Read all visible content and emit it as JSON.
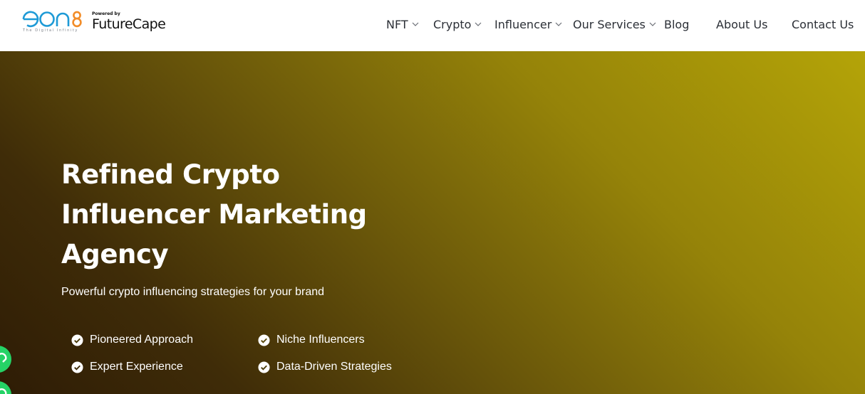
{
  "header": {
    "logo": {
      "brand_text": "eon8",
      "tagline": "The Digital Infinity",
      "powered_by": "Powered by",
      "partner": "FutureCape"
    },
    "nav": [
      {
        "label": "NFT",
        "has_dropdown": true
      },
      {
        "label": "Crypto",
        "has_dropdown": true
      },
      {
        "label": "Influencer",
        "has_dropdown": true
      },
      {
        "label": "Our Services",
        "has_dropdown": true
      },
      {
        "label": "Blog",
        "has_dropdown": false
      },
      {
        "label": "About Us",
        "has_dropdown": false
      },
      {
        "label": "Contact Us",
        "has_dropdown": false
      }
    ]
  },
  "hero": {
    "title_lines": [
      "Refined Crypto",
      "Influencer Marketing",
      "Agency"
    ],
    "subtitle": "Powerful crypto influencing strategies for your brand",
    "features": [
      {
        "label": "Pioneered Approach",
        "icon": "check-circle-icon"
      },
      {
        "label": "Niche Influencers",
        "icon": "check-circle-icon"
      },
      {
        "label": "Expert Experience",
        "icon": "check-circle-icon"
      },
      {
        "label": "Data-Driven Strategies",
        "icon": "check-circle-icon"
      }
    ]
  },
  "floating": {
    "whatsapp_icon": "whatsapp-icon",
    "call_icon": "phone-icon"
  },
  "colors": {
    "logo_blue": "#1e9ad6",
    "logo_orange": "#f28c28",
    "nav_text": "#2b2f36",
    "hero_gradient_start": "#b4a408",
    "hero_gradient_end": "#2e1c05",
    "whatsapp_green": "#25d366"
  }
}
